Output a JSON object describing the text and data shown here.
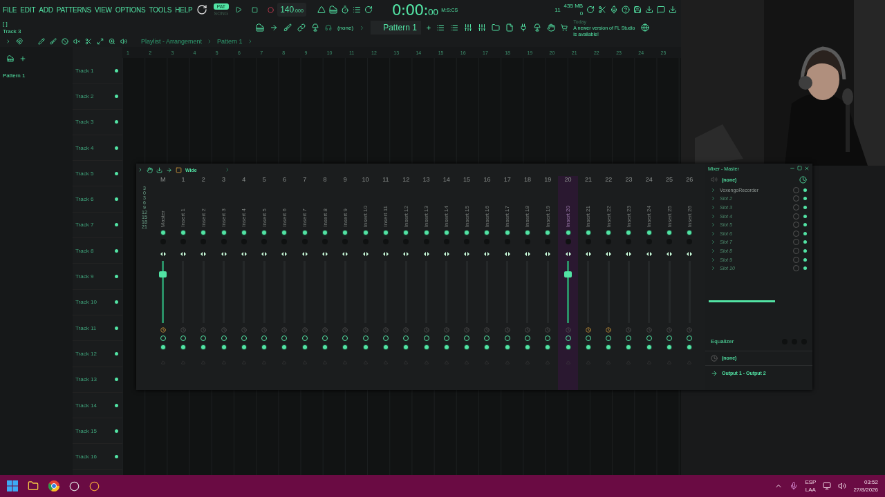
{
  "menu": [
    "FILE",
    "EDIT",
    "ADD",
    "PATTERNS",
    "VIEW",
    "OPTIONS",
    "TOOLS",
    "HELP"
  ],
  "transport": {
    "modes": [
      {
        "label": "PAT",
        "selected": true
      },
      {
        "label": "SONG",
        "selected": false
      }
    ],
    "tempo": "140",
    "tempo_fraction": ".000",
    "time": "0:00:",
    "time_cs": "00",
    "time_unit": "M:S:CS",
    "cpu": "11",
    "memory": "435 MB",
    "polyphony": "0"
  },
  "hint": {
    "brackets": "[ ]",
    "text": "Track 3"
  },
  "pattern_bar": {
    "snap": "(none)",
    "pattern": "Pattern 1",
    "add": "+"
  },
  "news": {
    "day": "Today",
    "message": "A newer version of FL Studio is available!"
  },
  "browser": {
    "items": [
      {
        "label": "Pattern 1"
      }
    ]
  },
  "playlist": {
    "breadcrumb": [
      "Playlist - Arrangement",
      "Pattern 1"
    ],
    "ruler": [
      "1",
      "2",
      "3",
      "4",
      "5",
      "6",
      "7",
      "8",
      "9",
      "10",
      "11",
      "12",
      "13",
      "14",
      "15",
      "16",
      "17",
      "18",
      "19",
      "20",
      "21",
      "22",
      "23",
      "24",
      "25"
    ],
    "tracks": [
      "Track 1",
      "Track 2",
      "Track 3",
      "Track 4",
      "Track 5",
      "Track 6",
      "Track 7",
      "Track 8",
      "Track 9",
      "Track 10",
      "Track 11",
      "Track 12",
      "Track 13",
      "Track 14",
      "Track 15",
      "Track 16"
    ]
  },
  "mixer": {
    "view": "Wide",
    "scale": [
      "3",
      "0",
      "3",
      "6",
      "9",
      "12",
      "15",
      "18",
      "21"
    ],
    "strips": [
      {
        "number": "M",
        "name": "Master",
        "selected": false,
        "level": 0.82,
        "send_active": true
      },
      {
        "number": "1",
        "name": "Insert 1",
        "selected": false,
        "send_active": false
      },
      {
        "number": "2",
        "name": "Insert 2",
        "selected": false,
        "send_active": false
      },
      {
        "number": "3",
        "name": "Insert 3",
        "selected": false,
        "send_active": false
      },
      {
        "number": "4",
        "name": "Insert 4",
        "selected": false,
        "send_active": false
      },
      {
        "number": "5",
        "name": "Insert 5",
        "selected": false,
        "send_active": false
      },
      {
        "number": "6",
        "name": "Insert 6",
        "selected": false,
        "send_active": false
      },
      {
        "number": "7",
        "name": "Insert 7",
        "selected": false,
        "send_active": false
      },
      {
        "number": "8",
        "name": "Insert 8",
        "selected": false,
        "send_active": false
      },
      {
        "number": "9",
        "name": "Insert 9",
        "selected": false,
        "send_active": false
      },
      {
        "number": "10",
        "name": "Insert 10",
        "selected": false,
        "send_active": false
      },
      {
        "number": "11",
        "name": "Insert 11",
        "selected": false,
        "send_active": false
      },
      {
        "number": "12",
        "name": "Insert 12",
        "selected": false,
        "send_active": false
      },
      {
        "number": "13",
        "name": "Insert 13",
        "selected": false,
        "send_active": false
      },
      {
        "number": "14",
        "name": "Insert 14",
        "selected": false,
        "send_active": false
      },
      {
        "number": "15",
        "name": "Insert 15",
        "selected": false,
        "send_active": false
      },
      {
        "number": "16",
        "name": "Insert 16",
        "selected": false,
        "send_active": false
      },
      {
        "number": "17",
        "name": "Insert 17",
        "selected": false,
        "send_active": false
      },
      {
        "number": "18",
        "name": "Insert 18",
        "selected": false,
        "send_active": false
      },
      {
        "number": "19",
        "name": "Insert 19",
        "selected": false,
        "send_active": false
      },
      {
        "number": "20",
        "name": "Insert 20",
        "selected": true,
        "level": 0.82,
        "send_active": false
      },
      {
        "number": "21",
        "name": "Insert 21",
        "selected": false,
        "send_active": true
      },
      {
        "number": "22",
        "name": "Insert 22",
        "selected": false,
        "send_active": true
      },
      {
        "number": "23",
        "name": "Insert 23",
        "selected": false,
        "send_active": false
      },
      {
        "number": "24",
        "name": "Insert 24",
        "selected": false,
        "send_active": false
      },
      {
        "number": "25",
        "name": "Insert 25",
        "selected": false,
        "send_active": false
      },
      {
        "number": "26",
        "name": "Insert 26",
        "selected": false,
        "send_active": false
      }
    ],
    "panel": {
      "title": "Mixer - Master",
      "input": "(none)",
      "slots": [
        {
          "name": "VoxengoRecorder",
          "filled": true
        },
        {
          "name": "Slot 2",
          "filled": false
        },
        {
          "name": "Slot 3",
          "filled": false
        },
        {
          "name": "Slot 4",
          "filled": false
        },
        {
          "name": "Slot 5",
          "filled": false
        },
        {
          "name": "Slot 6",
          "filled": false
        },
        {
          "name": "Slot 7",
          "filled": false
        },
        {
          "name": "Slot 8",
          "filled": false
        },
        {
          "name": "Slot 9",
          "filled": false
        },
        {
          "name": "Slot 10",
          "filled": false
        }
      ],
      "eq_label": "Equalizer",
      "eq_preset": "(none)",
      "output": "Output 1 - Output 2"
    }
  },
  "taskbar": {
    "language": "ESP",
    "layout": "LAA",
    "time": "03:52",
    "date": "27/8/2026"
  }
}
